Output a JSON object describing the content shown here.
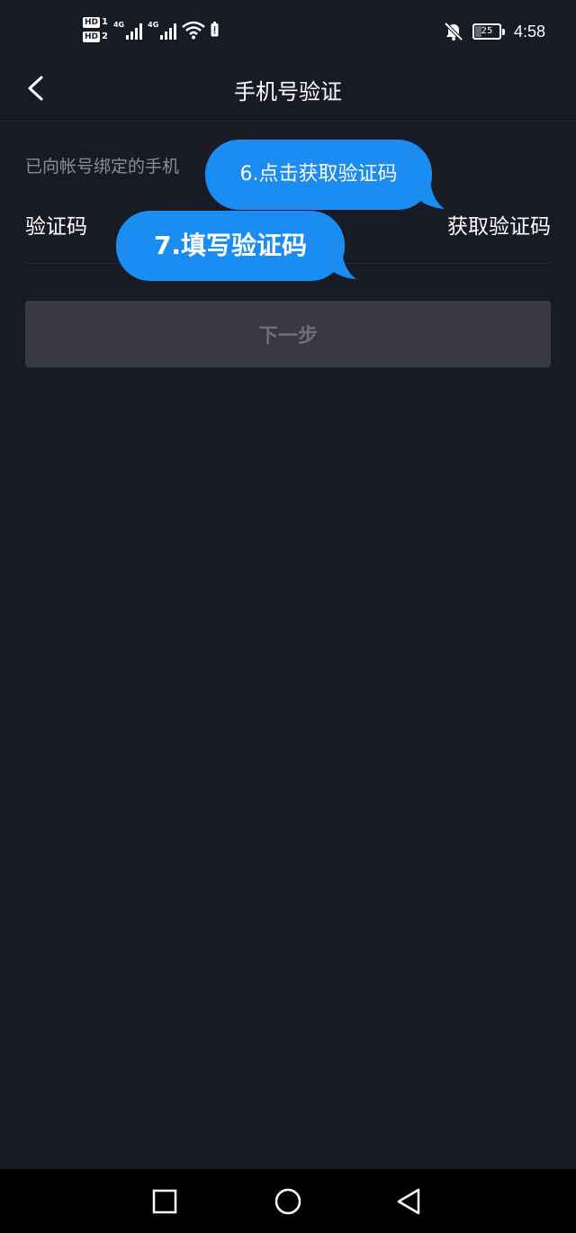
{
  "status_bar": {
    "sim1": "HD",
    "sim1_num": "1",
    "sim2": "HD",
    "sim2_num": "2",
    "network1": "4G",
    "network2": "4G",
    "battery_level": "25",
    "time": "4:58"
  },
  "header": {
    "title": "手机号验证",
    "back_icon": "chevron-left-icon"
  },
  "form": {
    "hint": "已向帐号绑定的手机",
    "code_label": "验证码",
    "get_code_label": "获取验证码",
    "next_label": "下一步"
  },
  "annotations": {
    "step6": "6.点击获取验证码",
    "step7": "7.填写验证码"
  },
  "nav_bar": {
    "recent_icon": "square-icon",
    "home_icon": "circle-icon",
    "back_icon": "triangle-back-icon"
  },
  "colors": {
    "background": "#181a25",
    "bubble": "#1a8cf2",
    "button_disabled": "#393943"
  }
}
